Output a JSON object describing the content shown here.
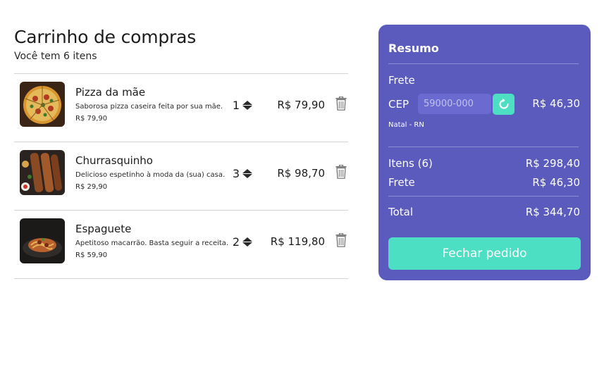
{
  "cart": {
    "title": "Carrinho de compras",
    "subtitle": "Você tem 6 itens",
    "items": [
      {
        "name": "Pizza da mãe",
        "description": "Saborosa pizza caseira feita por sua mãe.",
        "unit_price": "R$ 79,90",
        "quantity": "1",
        "total": "R$ 79,90",
        "image": "pizza-image"
      },
      {
        "name": "Churrasquinho",
        "description": "Delicioso espetinho à moda da (sua) casa.",
        "unit_price": "R$ 29,90",
        "quantity": "3",
        "total": "R$ 98,70",
        "image": "skewers-image"
      },
      {
        "name": "Espaguete",
        "description": "Apetitoso macarrão. Basta seguir a receita.",
        "unit_price": "R$ 59,90",
        "quantity": "2",
        "total": "R$ 119,80",
        "image": "spaghetti-image"
      }
    ]
  },
  "summary": {
    "title": "Resumo",
    "shipping_heading": "Frete",
    "cep_label": "CEP",
    "cep_placeholder": "59000-000",
    "shipping_cost": "R$ 46,30",
    "city": "Natal - RN",
    "items_label": "Itens (6)",
    "items_total": "R$ 298,40",
    "shipping_label": "Frete",
    "shipping_total": "R$ 46,30",
    "total_label": "Total",
    "total_value": "R$ 344,70",
    "checkout_label": "Fechar pedido"
  },
  "colors": {
    "panel": "#5b5bbd",
    "accent": "#4ddfc3",
    "text": "#1c1c1c"
  },
  "icons": {
    "stepper": "up-down-triangles-icon",
    "delete": "trash-icon",
    "refresh": "refresh-icon"
  }
}
